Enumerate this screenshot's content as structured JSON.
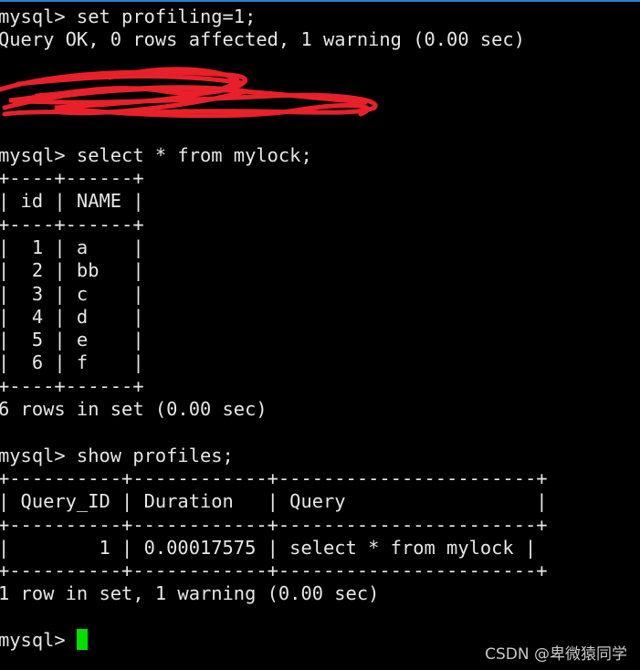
{
  "terminal": {
    "lines": [
      "mysql> set profiling=1;",
      "Query OK, 0 rows affected, 1 warning (0.00 sec)",
      "",
      "",
      "",
      "",
      "mysql> select * from mylock;",
      "+----+------+",
      "| id | NAME |",
      "+----+------+",
      "|  1 | a    |",
      "|  2 | bb   |",
      "|  3 | c    |",
      "|  4 | d    |",
      "|  5 | e    |",
      "|  6 | f    |",
      "+----+------+",
      "6 rows in set (0.00 sec)",
      "",
      "mysql> show profiles;",
      "+----------+------------+-----------------------+",
      "| Query_ID | Duration   | Query                 |",
      "+----------+------------+-----------------------+",
      "|        1 | 0.00017575 | select * from mylock |",
      "+----------+------------+-----------------------+",
      "1 row in set, 1 warning (0.00 sec)",
      ""
    ],
    "prompt": "mysql> "
  },
  "colors": {
    "text": "#e6e6e6",
    "cursor": "#00e000",
    "redaction": "#e8202a",
    "border": "#2a7fd4"
  },
  "watermark": "CSDN @卑微猿同学"
}
